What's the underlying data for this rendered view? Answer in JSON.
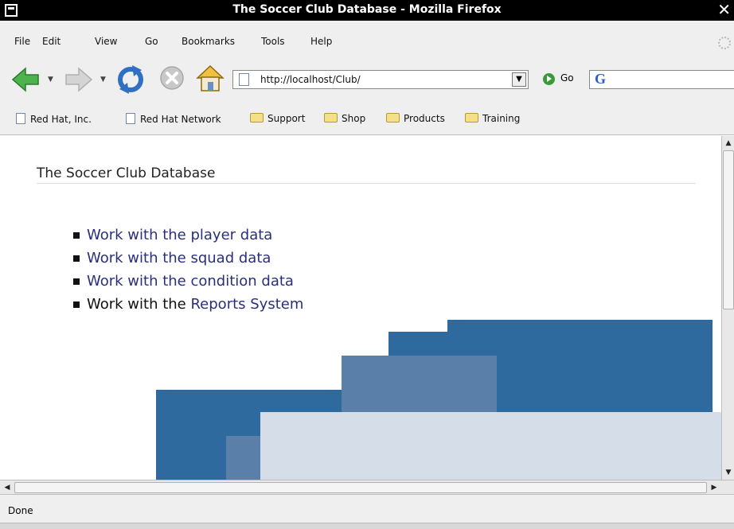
{
  "window": {
    "title": "The Soccer Club Database - Mozilla Firefox",
    "close_glyph": "✕"
  },
  "menubar": {
    "items": [
      "File",
      "Edit",
      "View",
      "Go",
      "Bookmarks",
      "Tools",
      "Help"
    ]
  },
  "navbar": {
    "url": "http://localhost/Club/",
    "go_label": "Go",
    "icons": [
      "back-arrow-icon",
      "forward-arrow-icon",
      "reload-icon",
      "stop-icon",
      "home-icon",
      "page-icon",
      "go-icon",
      "google-search-icon"
    ]
  },
  "bookmarks": {
    "items": [
      {
        "label": "Red Hat, Inc.",
        "icon": "document-icon"
      },
      {
        "label": "Red Hat Network",
        "icon": "document-icon"
      },
      {
        "label": "Support",
        "icon": "folder-icon"
      },
      {
        "label": "Shop",
        "icon": "folder-icon"
      },
      {
        "label": "Products",
        "icon": "folder-icon"
      },
      {
        "label": "Training",
        "icon": "folder-icon"
      }
    ]
  },
  "page": {
    "heading": "The Soccer Club Database",
    "links": [
      {
        "prefix": "",
        "link": "Work with the player data"
      },
      {
        "prefix": "",
        "link": "Work with the squad data"
      },
      {
        "prefix": "",
        "link": "Work with the condition data"
      },
      {
        "prefix": "Work with the ",
        "link": "Reports System"
      }
    ]
  },
  "statusbar": {
    "text": "Done"
  },
  "colors": {
    "link": "#2a2f7c",
    "block_dark": "#2e6a9e",
    "block_mid": "#5a7fa8",
    "block_light": "#d5dde8"
  }
}
